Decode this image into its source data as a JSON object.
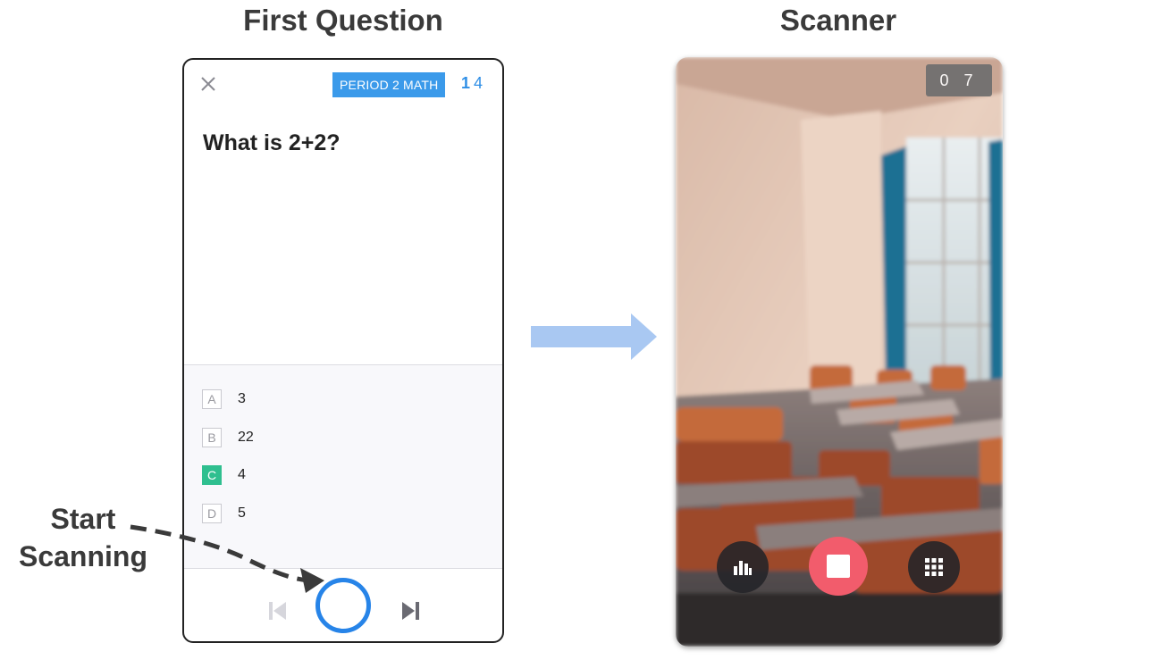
{
  "titles": {
    "left": "First Question",
    "right": "Scanner"
  },
  "phone1": {
    "class_badge": "PERIOD 2 MATH",
    "question_number": "1",
    "question_total": "4",
    "question": "What is 2+2?",
    "answers": [
      {
        "letter": "A",
        "text": "3",
        "correct": false
      },
      {
        "letter": "B",
        "text": "22",
        "correct": false
      },
      {
        "letter": "C",
        "text": "4",
        "correct": true
      },
      {
        "letter": "D",
        "text": "5",
        "correct": false
      }
    ]
  },
  "phone2": {
    "counter": "0 7"
  },
  "annotation": {
    "line1": "Start",
    "line2": "Scanning"
  },
  "colors": {
    "accent_blue": "#2784e8",
    "badge_blue": "#3b9aea",
    "correct_green": "#2fbf8f",
    "stop_red": "#f25c6c",
    "flow_arrow": "#a9c8f2"
  }
}
